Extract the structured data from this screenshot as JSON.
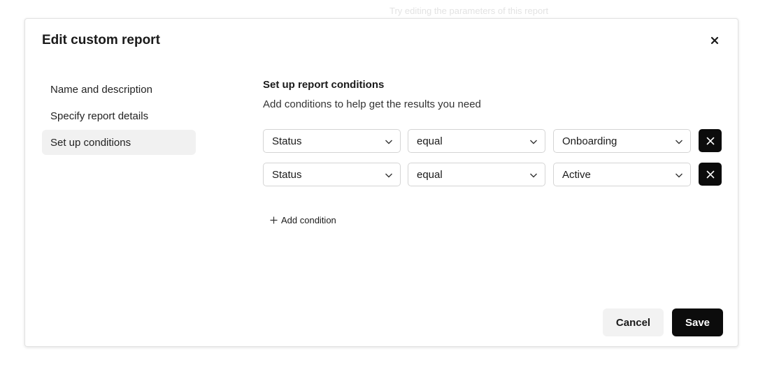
{
  "background_hint": "Try editing the parameters of this report",
  "dialog": {
    "title": "Edit custom report",
    "close_icon": "close-icon"
  },
  "nav": {
    "items": [
      {
        "label": "Name and description",
        "active": false
      },
      {
        "label": "Specify report details",
        "active": false
      },
      {
        "label": "Set up conditions",
        "active": true
      }
    ]
  },
  "conditions": {
    "title": "Set up report conditions",
    "description": "Add conditions to help get the results you need",
    "rows": [
      {
        "field": "Status",
        "operator": "equal",
        "value": "Onboarding"
      },
      {
        "field": "Status",
        "operator": "equal",
        "value": "Active"
      }
    ],
    "add_label": "Add condition"
  },
  "footer": {
    "cancel_label": "Cancel",
    "save_label": "Save"
  },
  "colors": {
    "primary": "#0c0c0c",
    "active_nav_bg": "#f1f1f1",
    "secondary_button_bg": "#f2f2f2"
  }
}
